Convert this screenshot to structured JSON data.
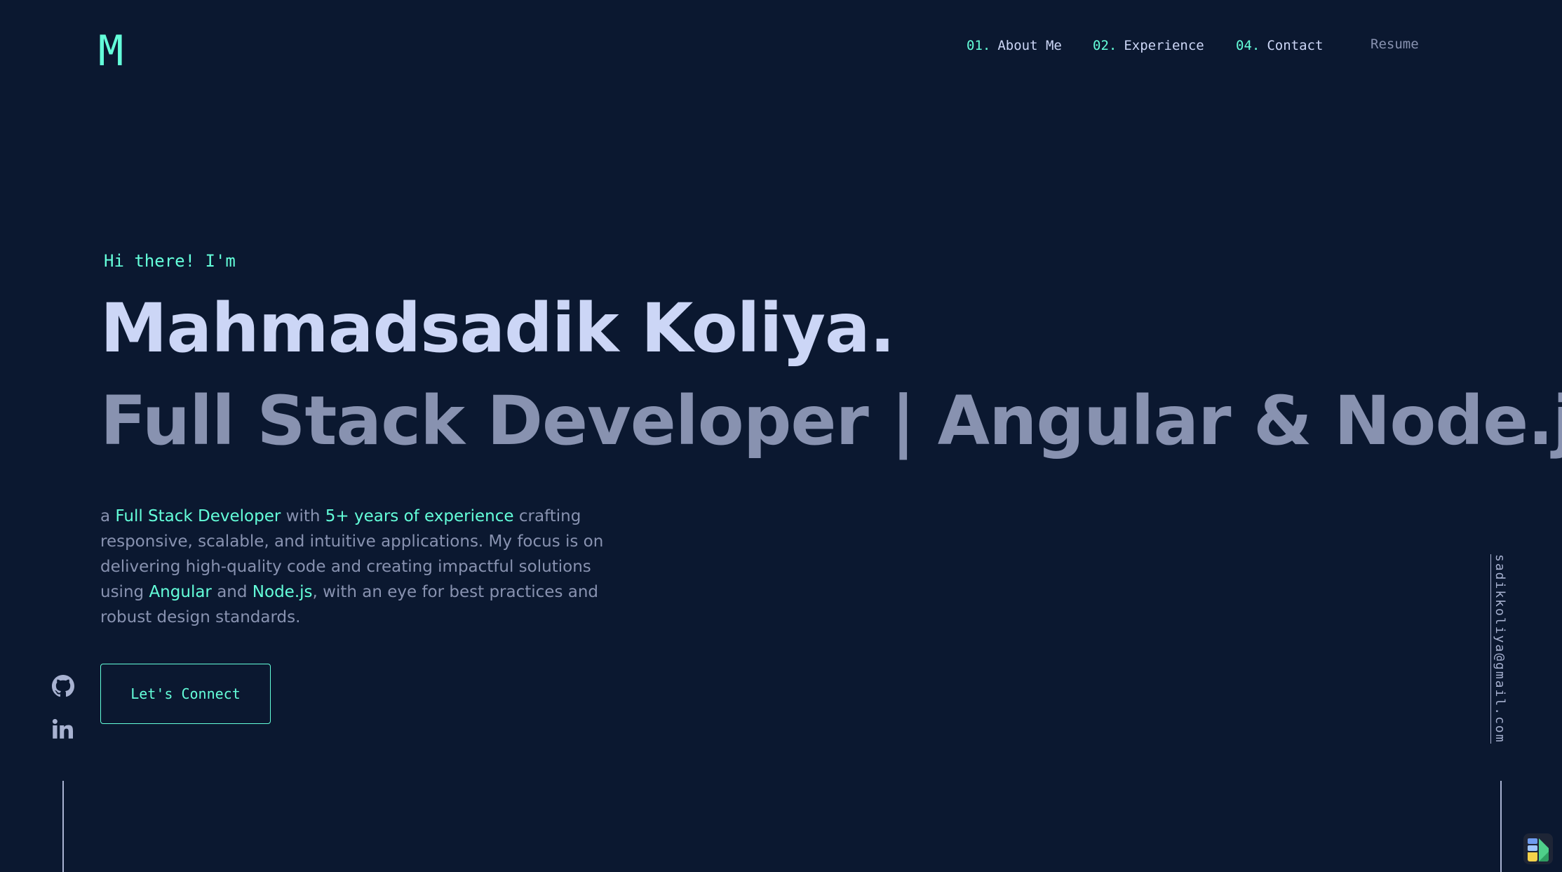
{
  "header": {
    "logo": "M",
    "nav": [
      {
        "num": "01.",
        "label": "About Me"
      },
      {
        "num": "02.",
        "label": "Experience"
      },
      {
        "num": "04.",
        "label": "Contact"
      }
    ],
    "resume_label": "Resume"
  },
  "hero": {
    "greeting": "Hi there! I'm",
    "name": "Mahmadsadik Koliya.",
    "role": "Full Stack Developer | Angular & Node.js",
    "bio": {
      "p1": "a ",
      "h1": "Full Stack Developer",
      "p2": " with ",
      "h2": "5+ years of experience",
      "p3": " crafting responsive, scalable, and intuitive applications. My focus is on delivering high-quality code and creating impactful solutions using ",
      "h3": "Angular",
      "p4": " and ",
      "h4": "Node.js",
      "p5": ", with an eye for best practices and robust design standards."
    },
    "cta_label": "Let's Connect"
  },
  "side": {
    "icons": [
      "github-icon",
      "linkedin-icon"
    ],
    "email": "sadikkoliya@gmail.com"
  },
  "colors": {
    "background": "#0b1830",
    "accent": "#64ffda",
    "heading": "#ccd6f6",
    "text": "#8892b0"
  }
}
